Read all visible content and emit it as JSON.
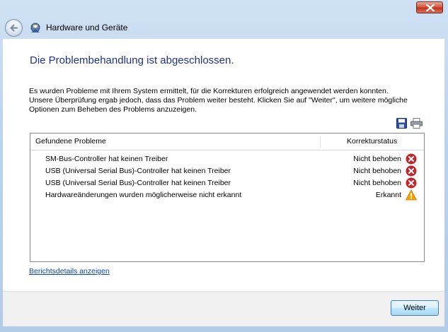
{
  "window": {
    "nav_title": "Hardware und Geräte"
  },
  "content": {
    "heading": "Die Problembehandlung ist abgeschlossen.",
    "description": "Es wurden Probleme mit Ihrem System ermittelt, für die Korrekturen erfolgreich angewendet werden konnten. Unsere Überprüfung ergab jedoch, dass das Problem weiter besteht. Klicken Sie auf \"Weiter\", um weitere mögliche Optionen zum Beheben des Problems anzuzeigen."
  },
  "table": {
    "col_problem": "Gefundene Probleme",
    "col_status": "Korrekturstatus",
    "rows": [
      {
        "problem": "SM-Bus-Controller hat keinen Treiber",
        "status": "Nicht behoben",
        "icon": "error-icon"
      },
      {
        "problem": "USB (Universal Serial Bus)-Controller hat keinen Treiber",
        "status": "Nicht behoben",
        "icon": "error-icon"
      },
      {
        "problem": "USB (Universal Serial Bus)-Controller hat keinen Treiber",
        "status": "Nicht behoben",
        "icon": "error-icon"
      },
      {
        "problem": "Hardwareänderungen wurden möglicherweise nicht erkannt",
        "status": "Erkannt",
        "icon": "warning-icon"
      }
    ]
  },
  "report_link": "Berichtsdetails anzeigen",
  "footer": {
    "next_label": "Weiter"
  },
  "colors": {
    "heading": "#1e3287",
    "error": "#c0282d",
    "warning": "#f0a30a",
    "link": "#0645ad"
  }
}
